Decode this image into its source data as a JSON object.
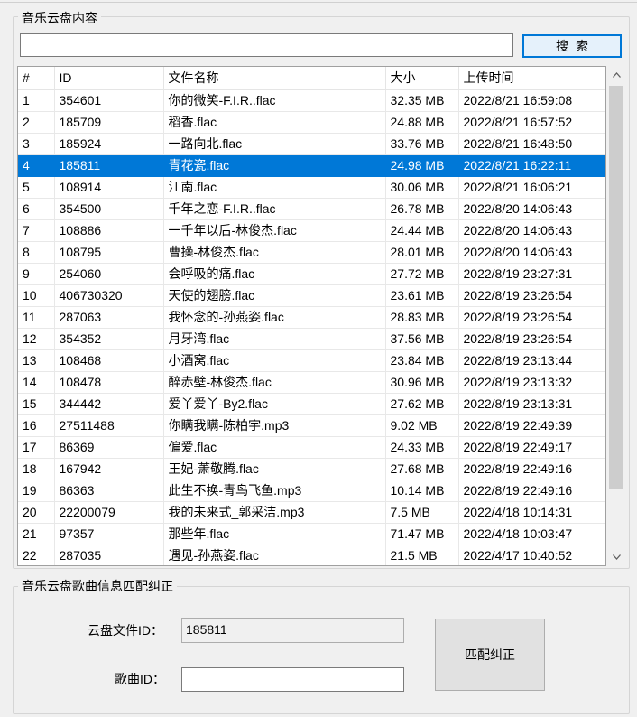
{
  "content_group": {
    "title": "音乐云盘内容",
    "search": {
      "value": "",
      "placeholder": "",
      "button_label": "搜索"
    }
  },
  "table": {
    "columns": [
      "#",
      "ID",
      "文件名称",
      "大小",
      "上传时间"
    ],
    "selected_index": 3,
    "rows": [
      [
        "1",
        "354601",
        "你的微笑-F.I.R..flac",
        "32.35 MB",
        "2022/8/21 16:59:08"
      ],
      [
        "2",
        "185709",
        "稻香.flac",
        "24.88 MB",
        "2022/8/21 16:57:52"
      ],
      [
        "3",
        "185924",
        "一路向北.flac",
        "33.76 MB",
        "2022/8/21 16:48:50"
      ],
      [
        "4",
        "185811",
        "青花瓷.flac",
        "24.98 MB",
        "2022/8/21 16:22:11"
      ],
      [
        "5",
        "108914",
        "江南.flac",
        "30.06 MB",
        "2022/8/21 16:06:21"
      ],
      [
        "6",
        "354500",
        "千年之恋-F.I.R..flac",
        "26.78 MB",
        "2022/8/20 14:06:43"
      ],
      [
        "7",
        "108886",
        "一千年以后-林俊杰.flac",
        "24.44 MB",
        "2022/8/20 14:06:43"
      ],
      [
        "8",
        "108795",
        "曹操-林俊杰.flac",
        "28.01 MB",
        "2022/8/20 14:06:43"
      ],
      [
        "9",
        "254060",
        "会呼吸的痛.flac",
        "27.72 MB",
        "2022/8/19 23:27:31"
      ],
      [
        "10",
        "406730320",
        "天使的翅膀.flac",
        "23.61 MB",
        "2022/8/19 23:26:54"
      ],
      [
        "11",
        "287063",
        "我怀念的-孙燕姿.flac",
        "28.83 MB",
        "2022/8/19 23:26:54"
      ],
      [
        "12",
        "354352",
        "月牙湾.flac",
        "37.56 MB",
        "2022/8/19 23:26:54"
      ],
      [
        "13",
        "108468",
        "小酒窝.flac",
        "23.84 MB",
        "2022/8/19 23:13:44"
      ],
      [
        "14",
        "108478",
        "醉赤壁-林俊杰.flac",
        "30.96 MB",
        "2022/8/19 23:13:32"
      ],
      [
        "15",
        "344442",
        "爱丫爱丫-By2.flac",
        "27.62 MB",
        "2022/8/19 23:13:31"
      ],
      [
        "16",
        "27511488",
        "你瞒我瞒-陈柏宇.mp3",
        "9.02 MB",
        "2022/8/19 22:49:39"
      ],
      [
        "17",
        "86369",
        "偏爱.flac",
        "24.33 MB",
        "2022/8/19 22:49:17"
      ],
      [
        "18",
        "167942",
        "王妃-萧敬腾.flac",
        "27.68 MB",
        "2022/8/19 22:49:16"
      ],
      [
        "19",
        "86363",
        "此生不换-青鸟飞鱼.mp3",
        "10.14 MB",
        "2022/8/19 22:49:16"
      ],
      [
        "20",
        "22200079",
        "我的未来式_郭采洁.mp3",
        "7.5 MB",
        "2022/4/18 10:14:31"
      ],
      [
        "21",
        "97357",
        "那些年.flac",
        "71.47 MB",
        "2022/4/18 10:03:47"
      ],
      [
        "22",
        "287035",
        "遇见-孙燕姿.flac",
        "21.5 MB",
        "2022/4/17 10:40:52"
      ]
    ]
  },
  "match_group": {
    "title": "音乐云盘歌曲信息匹配纠正",
    "cloud_file_id_label": "云盘文件ID：",
    "cloud_file_id_value": "185811",
    "song_id_label": "歌曲ID：",
    "song_id_value": "",
    "match_button_label": "匹配纠正"
  },
  "icons": {
    "scroll_up": "chevron-up-icon",
    "scroll_down": "chevron-down-icon"
  },
  "colors": {
    "selection": "#0078d7",
    "window_bg": "#f0f0f0"
  }
}
